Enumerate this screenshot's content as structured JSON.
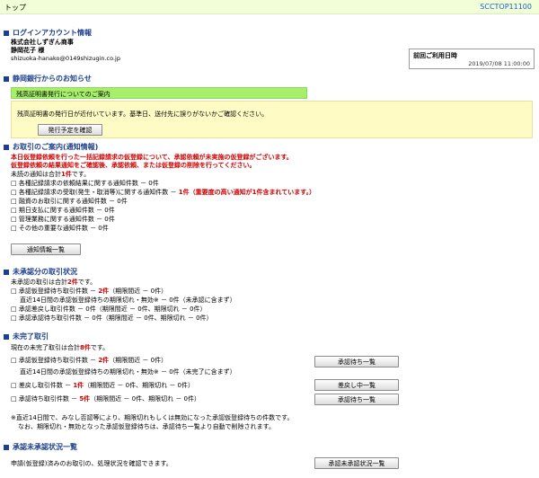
{
  "header": {
    "title": "トップ",
    "screen_code": "SCCTOP11100"
  },
  "login": {
    "section": "ログインアカウント情報",
    "company": "株式会社しずぎん商事",
    "user": "静岡花子 様",
    "email": "shizuoka-hanako@0149shizugin.co.jp",
    "last_login_label": "前回ご利用日時",
    "last_login_value": "2019/07/08 11:00:00"
  },
  "notice": {
    "section": "静岡銀行からのお知らせ",
    "title": "残高証明書発行についてのご案内",
    "body": "残高証明書の発行日が近付いています。基準日、送付先に誤りがないかご確認ください。",
    "button": "発行予定を確認"
  },
  "guide": {
    "section": "お取引のご案内(通知情報)",
    "warn1": "本日仮登録依頼を行った一括記録請求の仮登録について、承認依頼が未実施の仮登録がございます。",
    "warn2": "仮登録依頼の結果通知をご確認後、承認依頼、または仮登録の削除を行ってください。",
    "unread_pre": "未読の通知は合計",
    "unread_count": "1件",
    "unread_post": "です。",
    "items": [
      "各種記録請求の依頼結果に関する通知件数 － 0件",
      "各種記録請求の受取(発生・取消等)に関する通知件数 －",
      "融資のお取引に関する通知件数 － 0件",
      "期日支払に関する通知件数 － 0件",
      "管理業務に関する通知件数 － 0件",
      "その他の重要な通知件数 － 0件"
    ],
    "item2_red": "1件（重要度の高い通知が1件含まれています。）",
    "button": "通知情報一覧"
  },
  "unapproved": {
    "section": "未承認分の取引状況",
    "total_pre": "未承認の取引は合計",
    "total_count": "2件",
    "total_post": "です。",
    "l1_pre": "承認仮登録待ち取引件数 －",
    "l1_red": "2件",
    "l1_post": "（期限間近 － 0件）",
    "l2": "直近14日間の承認仮登録待ちの期限切れ・無効※ － 0件（未承認に含まず）",
    "l3": "承認差戻し取引件数 － 0件（期限間近 － 0件、期限切れ － 0件）",
    "l4": "承認承認待ち取引件数 － 0件（期限間近 － 0件、期限切れ － 0件）"
  },
  "incomplete": {
    "section": "未完了取引",
    "total_pre": "現在の未完了取引は合計",
    "total_count": "8件",
    "total_post": "です。",
    "l1_pre": "承認仮登録待ち取引件数 －",
    "l1_red": "2件",
    "l1_post": "（期限間近 － 0件）",
    "l2": "直近14日間の承認仮登録待ちの期限切れ・無効※ － 0件（未完了に含まず）",
    "l3_pre": "差戻し取引件数 －",
    "l3_red": "1件",
    "l3_post": "（期限間近 － 0件、期限切れ － 0件）",
    "l4_pre": "承認待ち取引件数 －",
    "l4_red": "5件",
    "l4_post": "（期限間近 － 0件、期限切れ － 0件）",
    "btn1": "承認待ち一覧",
    "btn2": "差戻し中一覧",
    "btn3": "承認待ち一覧",
    "note1": "※直近14日間で、みなし否認等により、期限切れもしくは無効になった承認仮登録待ちの件数です。",
    "note2": "なお、期限切れ・無効となった承認仮登録待ちは、承認待ち一覧より自動で削除されます。"
  },
  "status_list": {
    "section": "承認未承認状況一覧",
    "text": "申請(仮登録)済みのお取引の、処理状況を確認できます。",
    "button": "承認未承認状況一覧"
  }
}
